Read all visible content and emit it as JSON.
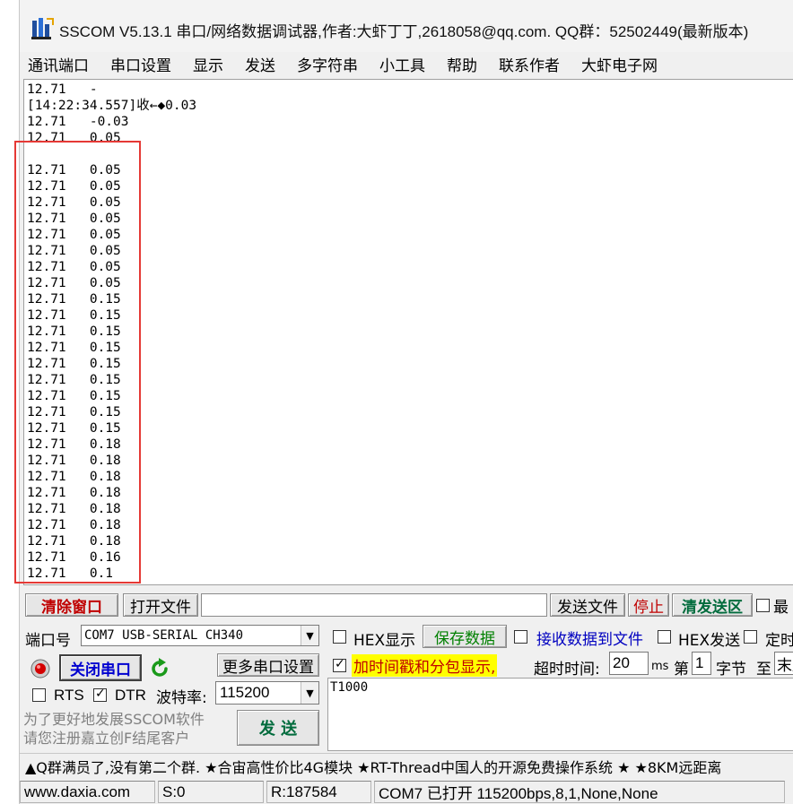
{
  "window": {
    "title": "SSCOM V5.13.1 串口/网络数据调试器,作者:大虾丁丁,2618058@qq.com. QQ群：52502449(最新版本)"
  },
  "menu": [
    "通讯端口",
    "串口设置",
    "显示",
    "发送",
    "多字符串",
    "小工具",
    "帮助",
    "联系作者",
    "大虾电子网"
  ],
  "receive": {
    "lines": [
      "12.71   -",
      "[14:22:34.557]收←◆0.03",
      "12.71   -0.03",
      "12.71   0.05",
      "",
      "12.71   0.05",
      "12.71   0.05",
      "12.71   0.05",
      "12.71   0.05",
      "12.71   0.05",
      "12.71   0.05",
      "12.71   0.05",
      "12.71   0.05",
      "12.71   0.15",
      "12.71   0.15",
      "12.71   0.15",
      "12.71   0.15",
      "12.71   0.15",
      "12.71   0.15",
      "12.71   0.15",
      "12.71   0.15",
      "12.71   0.15",
      "12.71   0.18",
      "12.71   0.18",
      "12.71   0.18",
      "12.71   0.18",
      "12.71   0.18",
      "12.71   0.18",
      "12.71   0.18",
      "12.71   0.16",
      "12.71   0.1"
    ]
  },
  "toolbar": {
    "clear_label": "清除窗口",
    "open_file_label": "打开文件",
    "file_path": "",
    "send_file_label": "发送文件",
    "stop_label": "停止",
    "clear_send_label": "清发送区",
    "last_label": "最"
  },
  "port": {
    "label": "端口号",
    "value": "COM7 USB-SERIAL CH340",
    "close_label": "关闭串口",
    "more_settings_label": "更多串口设置",
    "rts_label": "RTS",
    "dtr_label": "DTR",
    "baud_label": "波特率:",
    "baud_value": "115200",
    "promo_line1": "为了更好地发展SSCOM软件",
    "promo_line2": "请您注册嘉立创F结尾客户",
    "send_label": "发 送"
  },
  "options": {
    "hex_display_label": "HEX显示",
    "save_data_label": "保存数据",
    "recv_to_file_label": "接收数据到文件",
    "hex_send_label": "HEX发送",
    "timed_label": "定时",
    "timestamp_label": "加时间戳和分包显示,",
    "timeout_label": "超时时间:",
    "timeout_value": "20",
    "timeout_unit": "ms",
    "nth_label": "第",
    "nth_value": "1",
    "byte_label": "字节",
    "to_label": "至",
    "end_value": "末尾"
  },
  "send": {
    "text": "T1000"
  },
  "marquee": "▲Q群满员了,没有第二个群. ★合宙高性价比4G模块 ★RT-Thread中国人的开源免费操作系统 ★ ★8KM远距离",
  "status": {
    "site": "www.daxia.com",
    "sent": "S:0",
    "received": "R:187584",
    "port_state": "COM7 已打开  115200bps,8,1,None,None"
  },
  "colors": {
    "highlight": "#e53935",
    "clear_btn_text": "#c00000",
    "close_btn_text": "#0000d0",
    "save_btn_text": "#008000",
    "timestamp_bg": "#ffff00"
  }
}
